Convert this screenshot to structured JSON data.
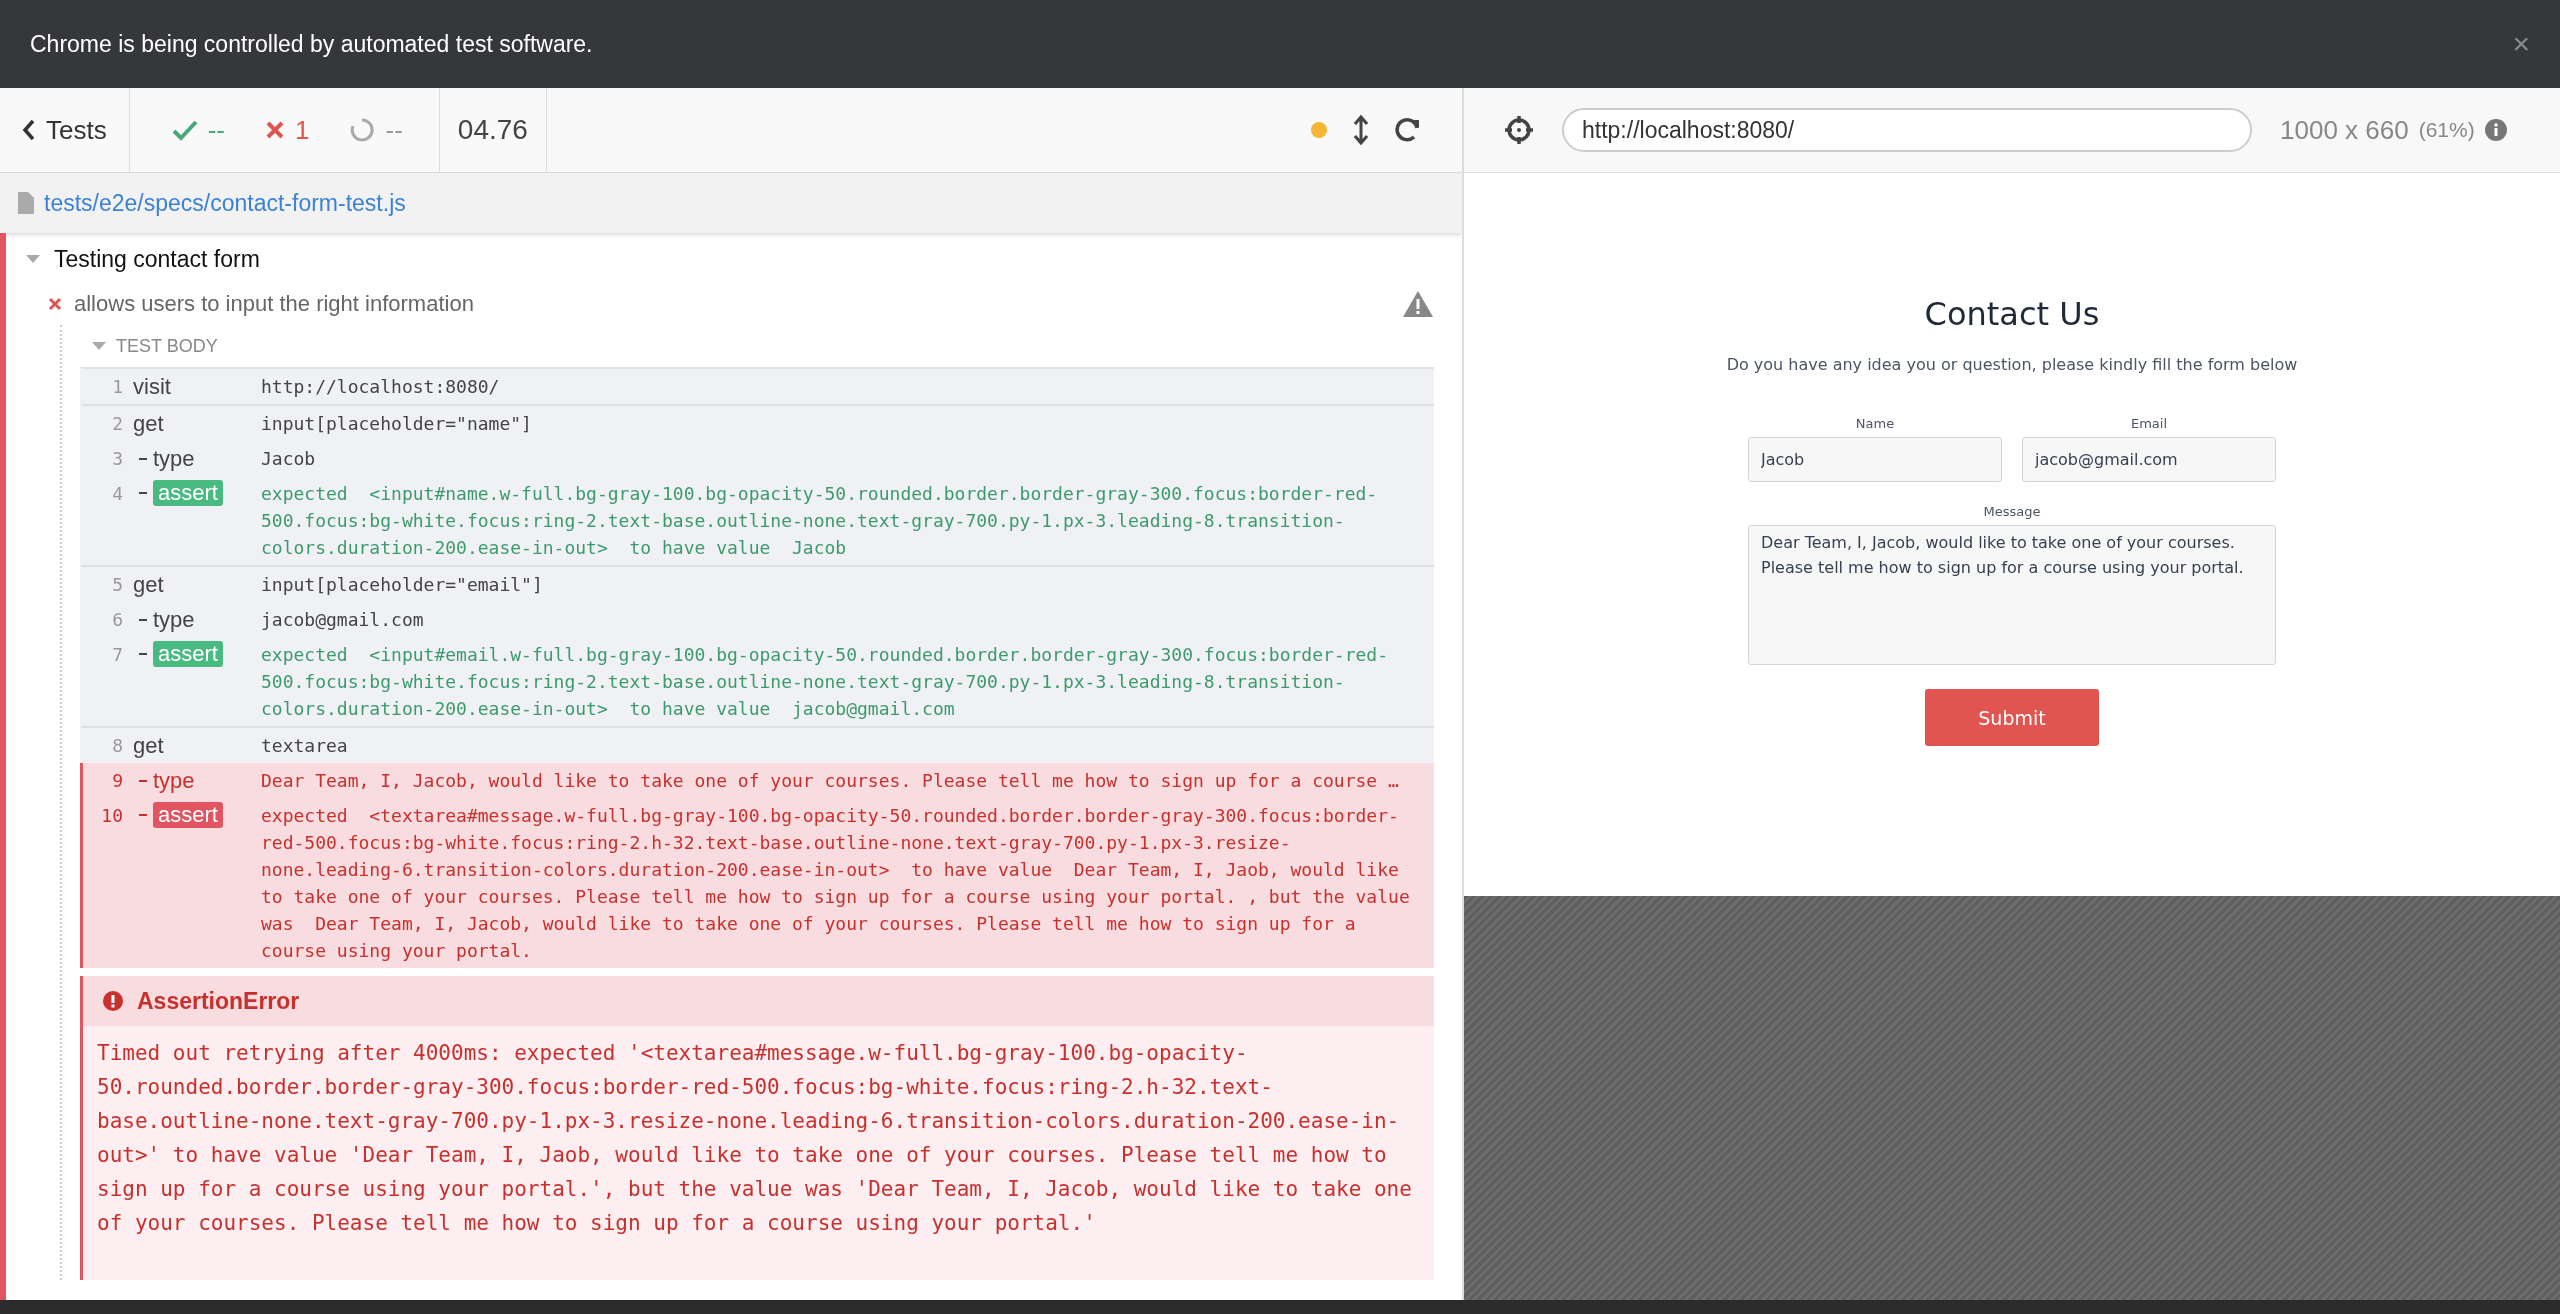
{
  "banner": {
    "text": "Chrome is being controlled by automated test software.",
    "close": "×"
  },
  "reporter": {
    "back": "Tests",
    "stats": [
      {
        "kind": "passed",
        "count": "--"
      },
      {
        "kind": "failed",
        "count": "1"
      },
      {
        "kind": "pending",
        "count": "--"
      }
    ],
    "duration": "04.76",
    "spec_path": "tests/e2e/specs/contact-form-test.js",
    "suite": {
      "title": "Testing contact form",
      "expanded": true
    },
    "test": {
      "title": "allows users to input the right information",
      "failed": true,
      "expanded": true
    },
    "body_label": "TEST BODY",
    "commands": [
      {
        "number": "1",
        "name": "visit",
        "child": false,
        "kind": "command",
        "failed": false,
        "message": "http://localhost:8080/"
      },
      {
        "number": "2",
        "name": "get",
        "child": false,
        "kind": "command",
        "failed": false,
        "message": "input[placeholder=\"name\"]"
      },
      {
        "number": "3",
        "name": "type",
        "child": true,
        "kind": "command",
        "failed": false,
        "message": "Jacob"
      },
      {
        "number": "4",
        "name": "assert",
        "child": true,
        "kind": "assert",
        "failed": false,
        "message": "expected  <input#name.w-full.bg-gray-100.bg-opacity-50.rounded.border.border-gray-300.focus:border-red-500.focus:bg-white.focus:ring-2.text-base.outline-none.text-gray-700.py-1.px-3.leading-8.transition-colors.duration-200.ease-in-out>  to have value  Jacob"
      },
      {
        "number": "5",
        "name": "get",
        "child": false,
        "kind": "command",
        "failed": false,
        "message": "input[placeholder=\"email\"]"
      },
      {
        "number": "6",
        "name": "type",
        "child": true,
        "kind": "command",
        "failed": false,
        "message": "jacob@gmail.com"
      },
      {
        "number": "7",
        "name": "assert",
        "child": true,
        "kind": "assert",
        "failed": false,
        "message": "expected  <input#email.w-full.bg-gray-100.bg-opacity-50.rounded.border.border-gray-300.focus:border-red-500.focus:bg-white.focus:ring-2.text-base.outline-none.text-gray-700.py-1.px-3.leading-8.transition-colors.duration-200.ease-in-out>  to have value  jacob@gmail.com"
      },
      {
        "number": "8",
        "name": "get",
        "child": false,
        "kind": "command",
        "failed": false,
        "message": "textarea"
      },
      {
        "number": "9",
        "name": "type",
        "child": true,
        "kind": "command",
        "failed": true,
        "message": "Dear Team, I, Jacob, would like to take one of your courses. Please tell me how to sign up for a course …"
      },
      {
        "number": "10",
        "name": "assert",
        "child": true,
        "kind": "assert",
        "failed": true,
        "message": "expected  <textarea#message.w-full.bg-gray-100.bg-opacity-50.rounded.border.border-gray-300.focus:border-red-500.focus:bg-white.focus:ring-2.h-32.text-base.outline-none.text-gray-700.py-1.px-3.resize-none.leading-6.transition-colors.duration-200.ease-in-out>  to have value  Dear Team, I, Jaob, would like to take one of your courses. Please tell me how to sign up for a course using your portal. , but the value was  Dear Team, I, Jacob, would like to take one of your courses. Please tell me how to sign up for a course using your portal."
      }
    ],
    "error": {
      "name": "AssertionError",
      "message": "Timed out retrying after 4000ms: expected '<textarea#message.w-full.bg-gray-100.bg-opacity-50.rounded.border.border-gray-300.focus:border-red-500.focus:bg-white.focus:ring-2.h-32.text-base.outline-none.text-gray-700.py-1.px-3.resize-none.leading-6.transition-colors.duration-200.ease-in-out>' to have value 'Dear Team, I, Jaob, would like to take one of your courses. Please tell me how to sign up for a course using your portal.', but the value was 'Dear Team, I, Jacob, would like to take one of your courses. Please tell me how to sign up for a course using your portal.'"
    }
  },
  "aut": {
    "url": "http://localhost:8080/",
    "viewport": "1000 x 660",
    "scale": "(61%)",
    "page": {
      "title": "Contact Us",
      "subtitle": "Do you have any idea you or question, please kindly fill the form below",
      "fields": [
        {
          "kind": "input",
          "label": "Name",
          "value": "Jacob"
        },
        {
          "kind": "input",
          "label": "Email",
          "value": "jacob@gmail.com"
        },
        {
          "kind": "textarea",
          "label": "Message",
          "value": "Dear Team, I, Jacob, would like to take one of your courses. Please tell me how to sign up for a course using your portal."
        }
      ],
      "submit": "Submit"
    }
  }
}
